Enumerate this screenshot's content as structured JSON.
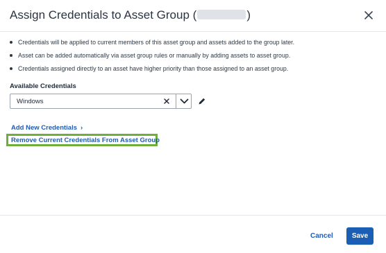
{
  "dialog": {
    "title": "Assign Credentials to Asset Group",
    "title_open": "(",
    "title_close": ")"
  },
  "bullets": [
    "Credentials will be applied to current members of this asset group and assets added to the group later.",
    "Asset can be added automatically via asset group rules or manually by adding assets to asset group.",
    "Credentials assigned directly to an asset have higher priority than those assigned to an asset group."
  ],
  "credentials": {
    "label": "Available Credentials",
    "selected": "Windows"
  },
  "links": {
    "add_new": "Add New Credentials",
    "remove_current": "Remove Current Credentials From Asset Group"
  },
  "footer": {
    "cancel": "Cancel",
    "save": "Save"
  },
  "colors": {
    "link": "#1f5bb0",
    "primary_button": "#1a5fb4",
    "highlight_border": "#6fae3a"
  },
  "icons": [
    "close-icon",
    "clear-icon",
    "chevron-down-icon",
    "pencil-icon",
    "chevron-right-icon"
  ]
}
